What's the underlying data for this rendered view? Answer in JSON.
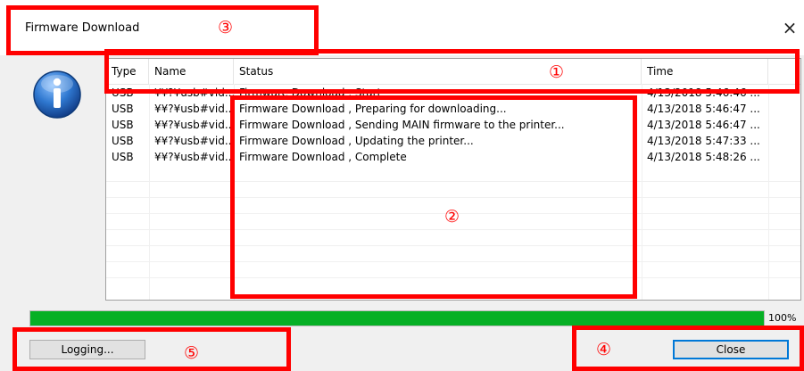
{
  "window": {
    "title": "Firmware Download",
    "close_glyph": "×"
  },
  "icon": {
    "name": "info-icon"
  },
  "list": {
    "columns": [
      "Type",
      "Name",
      "Status",
      "Time"
    ],
    "rows": [
      [
        "USB",
        "¥¥?¥usb#vid...",
        "Firmware Download , Start",
        "4/13/2018 5:46:46 ..."
      ],
      [
        "USB",
        "¥¥?¥usb#vid...",
        "Firmware Download , Preparing for downloading...",
        "4/13/2018 5:46:47 ..."
      ],
      [
        "USB",
        "¥¥?¥usb#vid...",
        "Firmware Download , Sending MAIN firmware to the printer...",
        "4/13/2018 5:46:47 ..."
      ],
      [
        "USB",
        "¥¥?¥usb#vid...",
        "Firmware Download , Updating the printer...",
        "4/13/2018 5:47:33 ..."
      ],
      [
        "USB",
        "¥¥?¥usb#vid...",
        "Firmware Download , Complete",
        "4/13/2018 5:48:26 ..."
      ]
    ]
  },
  "progress": {
    "fraction": 1.0,
    "label": "100%",
    "color": "#06b025"
  },
  "buttons": {
    "logging": "Logging...",
    "close": "Close"
  },
  "annotations": {
    "color": "#ff0000",
    "labels": [
      "①",
      "②",
      "③",
      "④",
      "⑤"
    ]
  }
}
